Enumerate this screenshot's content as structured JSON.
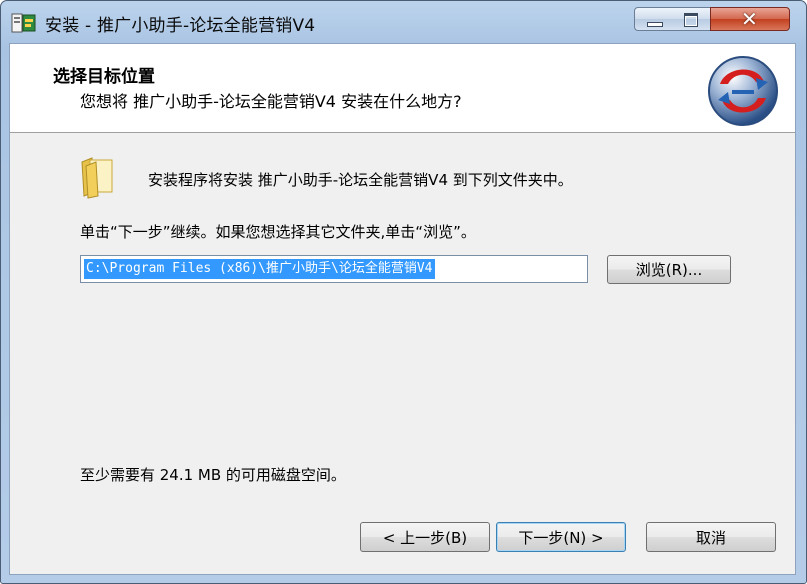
{
  "window": {
    "title": "安装 - 推广小助手-论坛全能营销V4",
    "minimize_icon": "minimize-icon",
    "maximize_icon": "maximize-icon",
    "close_icon": "close-icon",
    "close_glyph": "✕"
  },
  "header": {
    "heading": "选择目标位置",
    "subheading": "您想将 推广小助手-论坛全能营销V4 安装在什么地方?",
    "logo_icon": "setup-logo-icon"
  },
  "body": {
    "folder_icon": "folder-icon",
    "install_text": "安装程序将安装 推广小助手-论坛全能营销V4 到下列文件夹中。",
    "instruction_text": "单击“下一步”继续。如果您想选择其它文件夹,单击“浏览”。",
    "path_value": "C:\\Program Files (x86)\\推广小助手\\论坛全能营销V4",
    "browse_label": "浏览(R)...",
    "space_text": "至少需要有 24.1 MB 的可用磁盘空间。"
  },
  "footer": {
    "back_label": "< 上一步(B)",
    "next_label": "下一步(N) >",
    "cancel_label": "取消"
  },
  "colors": {
    "accent": "#3399ff",
    "title_bar": "#a9c4e3",
    "close_button": "#c2401f"
  }
}
